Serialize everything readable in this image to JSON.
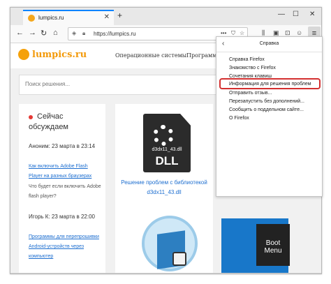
{
  "browser": {
    "tab_title": "lumpics.ru",
    "tab_close": "✕",
    "new_tab": "+",
    "url": "https://lumpics.ru",
    "window_controls": {
      "minimize": "—",
      "maximize": "☐",
      "close": "✕"
    }
  },
  "site": {
    "logo": "lumpics.ru",
    "nav": [
      "Операционные системы",
      "Программы"
    ],
    "search_placeholder": "Поиск решения..."
  },
  "sidebar": {
    "live_title": "Сейчас обсуждаем",
    "comments": [
      {
        "author": "Аноним: 23 марта в 23:14",
        "link": "Как включить Adobe Flash Player на разных браузерах",
        "text": "Что будет если включить Adobe flash player?"
      },
      {
        "author": "Игорь К: 23 марта в 22:00",
        "link": "Программы для перепрошивки Android-устройств через компьютер"
      }
    ]
  },
  "article": {
    "dll_filename": "d3dx11_43.dll",
    "dll_label": "DLL",
    "link": "Решение проблем с библиотекой d3dx11_43.dll",
    "boot_card": "Boot Menu"
  },
  "menu": {
    "back": "‹",
    "title": "Справка",
    "items": [
      "Справка Firefox",
      "Знакомство с Firefox",
      "Сочетания клавиш",
      "Информация для решения проблем",
      "Отправить отзыв...",
      "Перезапустить без дополнений...",
      "Сообщить о поддельном сайте...",
      "О Firefox"
    ],
    "highlighted_index": 3
  },
  "colors": {
    "accent": "#0a84ff",
    "logo": "#f39a0a",
    "link": "#1e6fd0",
    "highlight_box": "#d32f2f"
  }
}
